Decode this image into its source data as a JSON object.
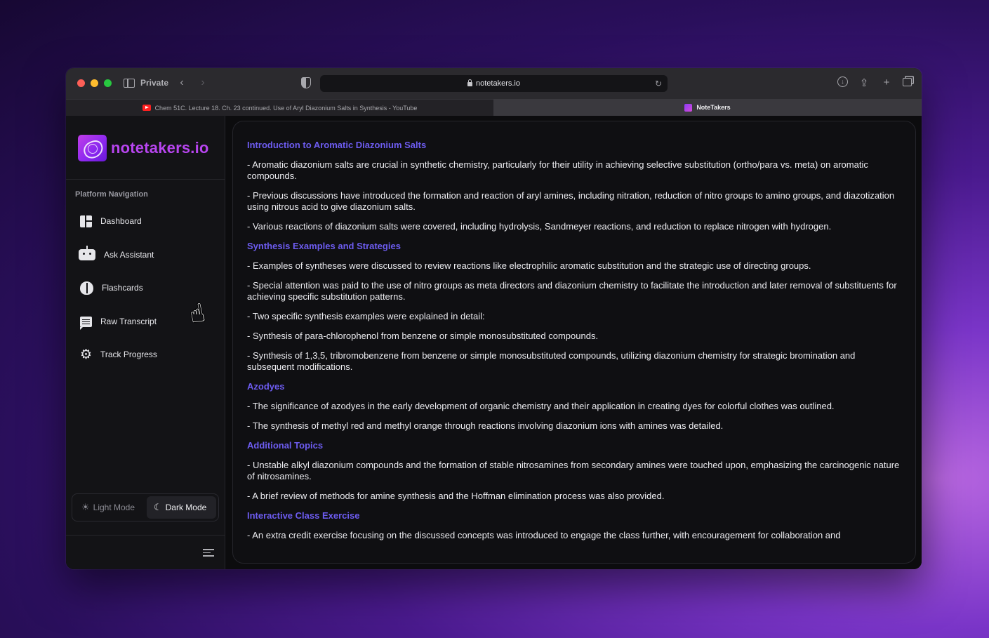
{
  "browser": {
    "private_label": "Private",
    "url": "notetakers.io",
    "tabs": [
      {
        "label": "Chem 51C. Lecture 18. Ch. 23 continued. Use of Aryl Diazonium Salts in Synthesis - YouTube",
        "icon": "youtube-icon",
        "active": false
      },
      {
        "label": "NoteTakers",
        "icon": "notetakers-icon",
        "active": true
      }
    ]
  },
  "sidebar": {
    "brand": "notetakers.io",
    "nav_heading": "Platform Navigation",
    "items": [
      {
        "label": "Dashboard",
        "icon": "dashboard-icon"
      },
      {
        "label": "Ask Assistant",
        "icon": "robot-icon"
      },
      {
        "label": "Flashcards",
        "icon": "brain-icon"
      },
      {
        "label": "Raw Transcript",
        "icon": "chat-icon"
      },
      {
        "label": "Track Progress",
        "icon": "gear-icon"
      }
    ],
    "mode": {
      "light_label": "Light Mode",
      "dark_label": "Dark Mode",
      "selected": "Dark Mode"
    }
  },
  "notes": {
    "sections": [
      {
        "title": "Introduction to Aromatic Diazonium Salts",
        "items": [
          "- Aromatic diazonium salts are crucial in synthetic chemistry, particularly for their utility in achieving selective substitution (ortho/para vs. meta) on aromatic compounds.",
          "- Previous discussions have introduced the formation and reaction of aryl amines, including nitration, reduction of nitro groups to amino groups, and diazotization using nitrous acid to give diazonium salts.",
          "- Various reactions of diazonium salts were covered, including hydrolysis, Sandmeyer reactions, and reduction to replace nitrogen with hydrogen."
        ]
      },
      {
        "title": "Synthesis Examples and Strategies",
        "items": [
          "- Examples of syntheses were discussed to review reactions like electrophilic aromatic substitution and the strategic use of directing groups.",
          "- Special attention was paid to the use of nitro groups as meta directors and diazonium chemistry to facilitate the introduction and later removal of substituents for achieving specific substitution patterns.",
          "- Two specific synthesis examples were explained in detail:",
          "- Synthesis of para-chlorophenol from benzene or simple monosubstituted compounds.",
          "- Synthesis of 1,3,5, tribromobenzene from benzene or simple monosubstituted compounds, utilizing diazonium chemistry for strategic bromination and subsequent modifications."
        ]
      },
      {
        "title": "Azodyes",
        "items": [
          "- The significance of azodyes in the early development of organic chemistry and their application in creating dyes for colorful clothes was outlined.",
          "- The synthesis of methyl red and methyl orange through reactions involving diazonium ions with amines was detailed."
        ]
      },
      {
        "title": "Additional Topics",
        "items": [
          "- Unstable alkyl diazonium compounds and the formation of stable nitrosamines from secondary amines were touched upon, emphasizing the carcinogenic nature of nitrosamines.",
          "- A brief review of methods for amine synthesis and the Hoffman elimination process was also provided."
        ]
      },
      {
        "title": "Interactive Class Exercise",
        "items": [
          "- An extra credit exercise focusing on the discussed concepts was introduced to engage the class further, with encouragement for collaboration and"
        ]
      }
    ]
  },
  "colors": {
    "accent": "#6d5cf0",
    "brand": "#b845f0"
  }
}
